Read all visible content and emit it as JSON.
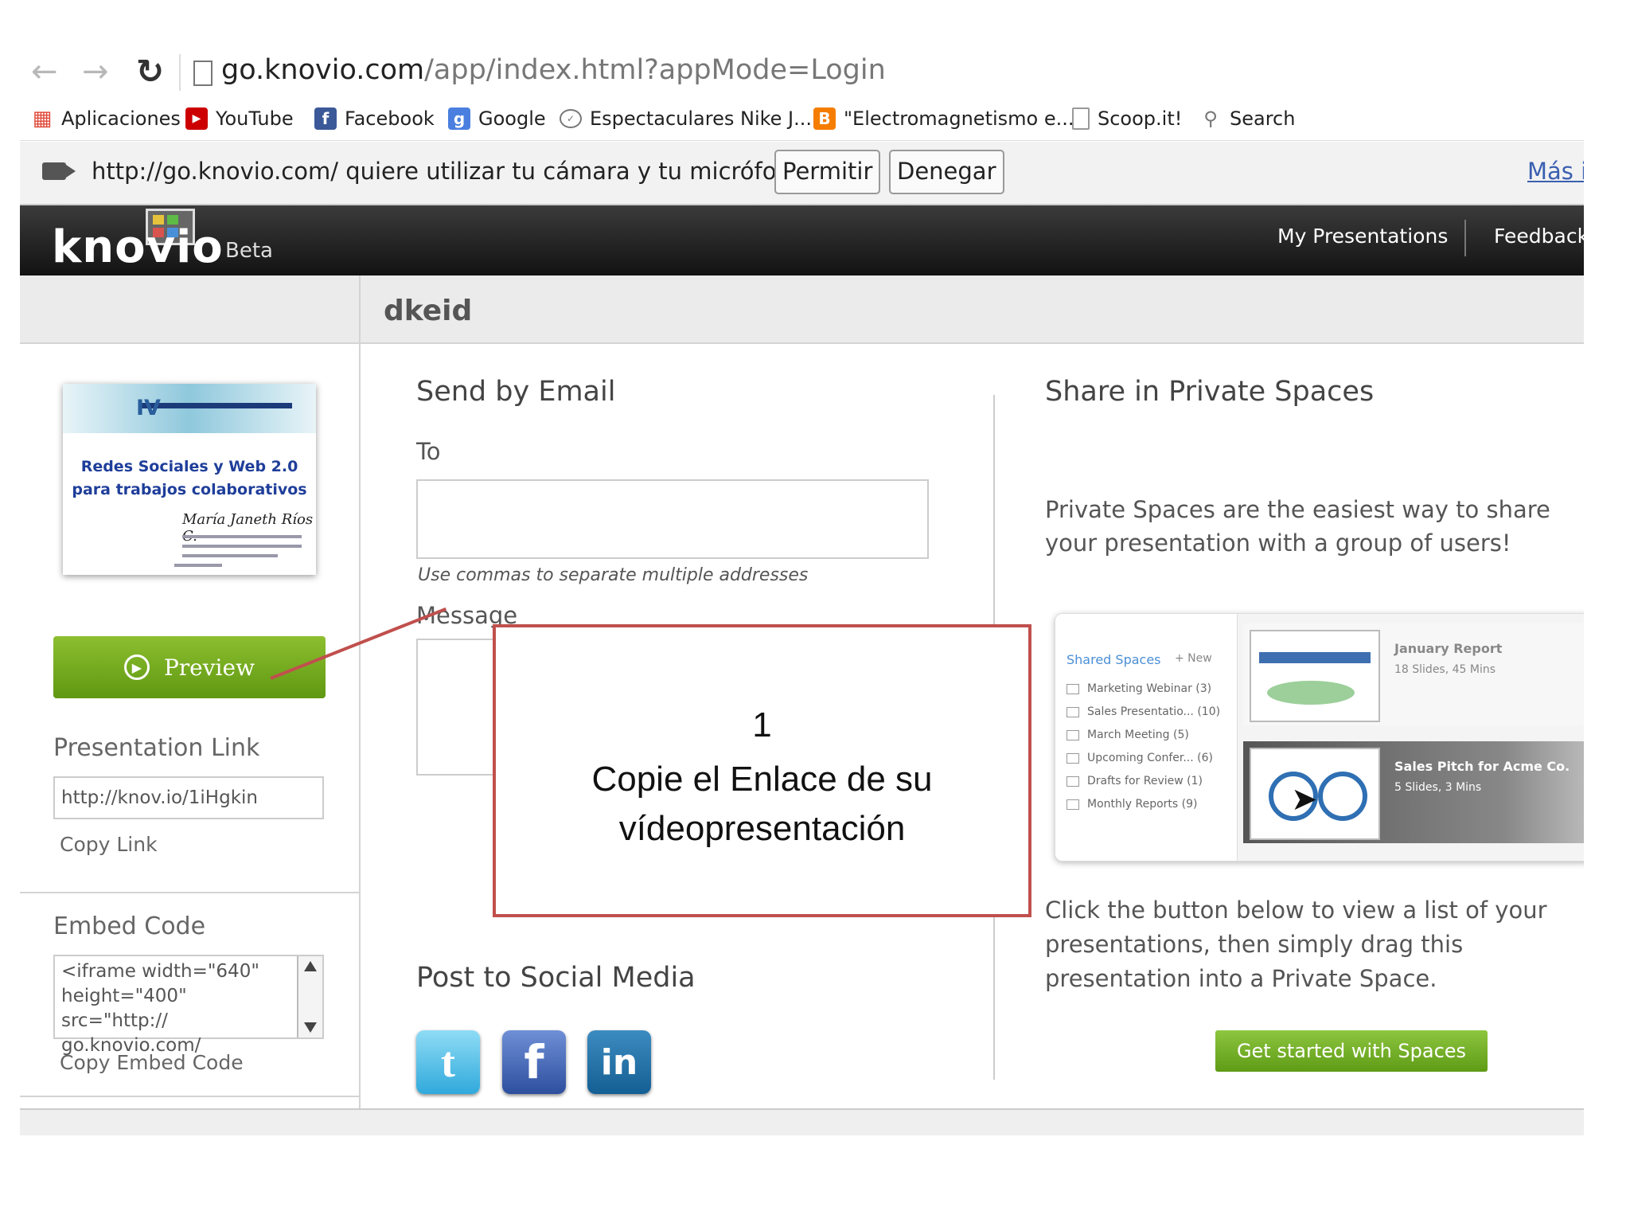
{
  "browser": {
    "url_host": "go.knovio.com",
    "url_path": "/app/index.html?appMode=Login",
    "bookmarks": [
      "Aplicaciones",
      "YouTube",
      "Facebook",
      "Google",
      "Espectaculares Nike J...",
      "\"Electromagnetismo e...",
      "Scoop.it!",
      "Search"
    ]
  },
  "infobar": {
    "message": "http://go.knovio.com/ quiere utilizar tu cámara y tu micrófono.",
    "allow_label": "Permitir",
    "deny_label": "Denegar",
    "more_label": "Más ir"
  },
  "app": {
    "logo": "knovio",
    "beta": "Beta",
    "nav": {
      "my_presentations": "My Presentations",
      "feedback": "Feedback"
    },
    "page_title": "dkeid"
  },
  "sidebar": {
    "thumbnail": {
      "badge": "IV",
      "title_line1": "Redes Sociales y Web 2.0",
      "title_line2": "para trabajos colaborativos",
      "author": "María Janeth Ríos C."
    },
    "preview_label": "Preview",
    "presentation_link_heading": "Presentation Link",
    "presentation_link_value": "http://knov.io/1iHgkin",
    "copy_link": "Copy Link",
    "embed_heading": "Embed Code",
    "embed_value": "<iframe width=\"640\"\nheight=\"400\" src=\"http://\ngo.knovio.com/",
    "copy_embed": "Copy Embed Code"
  },
  "email": {
    "heading": "Send by Email",
    "to_label": "To",
    "to_hint": "Use commas to separate multiple addresses",
    "message_label": "Message"
  },
  "social": {
    "heading": "Post to Social Media",
    "icons": [
      "twitter-icon",
      "facebook-icon",
      "linkedin-icon"
    ]
  },
  "spaces": {
    "heading": "Share in Private Spaces",
    "description": "Private Spaces are the easiest way to share your presentation with a group of users!",
    "preview": {
      "title": "Shared Spaces",
      "new_label": "+ New",
      "items": [
        "Marketing Webinar (3)",
        "Sales Presentatio... (10)",
        "March Meeting (5)",
        "Upcoming Confer... (6)",
        "Drafts for Review (1)",
        "Monthly Reports (9)"
      ],
      "cards": [
        {
          "title": "January Report",
          "subtitle": "18 Slides, 45 Mins"
        },
        {
          "title": "Sales Pitch for Acme Co.",
          "subtitle": "5 Slides, 3 Mins"
        }
      ]
    },
    "instructions": "Click the button below to view a list of your presentations, then simply drag this presentation into a Private Space.",
    "button_label": "Get started with Spaces"
  },
  "annotation": {
    "number": "1",
    "text": "Copie el Enlace de su vídeopresentación"
  },
  "colors": {
    "accent_green": "#6fa51c",
    "annotation_red": "#c0504d",
    "header_dark": "#1e1e1e"
  }
}
